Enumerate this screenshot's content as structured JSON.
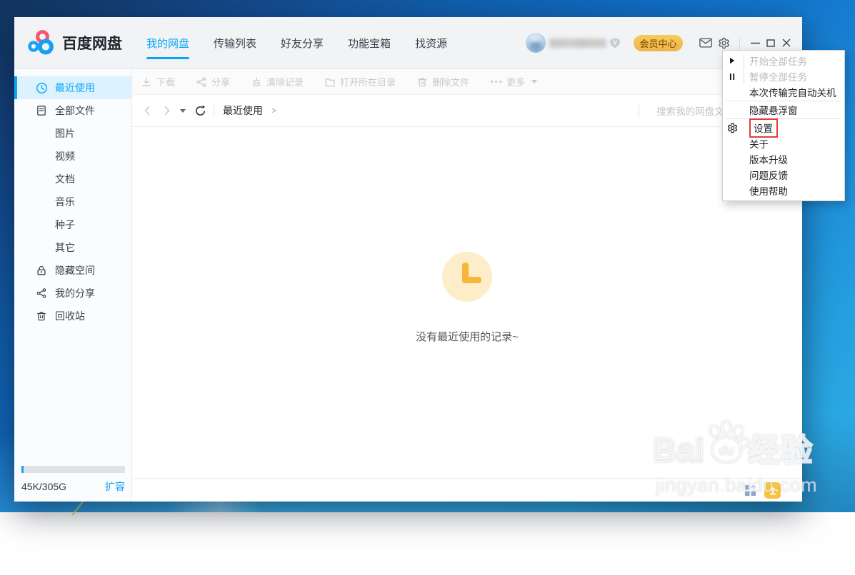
{
  "app": {
    "title": "百度网盘"
  },
  "titlebar": {
    "nav": [
      {
        "label": "我的网盘",
        "active": true
      },
      {
        "label": "传输列表",
        "active": false
      },
      {
        "label": "好友分享",
        "active": false
      },
      {
        "label": "功能宝箱",
        "active": false
      },
      {
        "label": "找资源",
        "active": false
      }
    ],
    "member_button": "会员中心"
  },
  "toolbar": {
    "buttons": [
      {
        "label": "下载",
        "icon": "download"
      },
      {
        "label": "分享",
        "icon": "share"
      },
      {
        "label": "清除记录",
        "icon": "clear"
      },
      {
        "label": "打开所在目录",
        "icon": "folder"
      },
      {
        "label": "删除文件",
        "icon": "trash"
      },
      {
        "label": "更多",
        "icon": "more",
        "chevron": true
      }
    ]
  },
  "breadcrumb": {
    "current": "最近使用",
    "chevron": ">"
  },
  "search": {
    "placeholder": "搜索我的网盘文件"
  },
  "sidebar": {
    "items": [
      {
        "label": "最近使用",
        "icon": "clock",
        "active": true
      },
      {
        "label": "全部文件",
        "icon": "file"
      },
      {
        "label": "图片",
        "indent": true
      },
      {
        "label": "视频",
        "indent": true
      },
      {
        "label": "文档",
        "indent": true
      },
      {
        "label": "音乐",
        "indent": true
      },
      {
        "label": "种子",
        "indent": true
      },
      {
        "label": "其它",
        "indent": true
      },
      {
        "label": "隐藏空间",
        "icon": "lock"
      },
      {
        "label": "我的分享",
        "icon": "share"
      },
      {
        "label": "回收站",
        "icon": "trash"
      }
    ],
    "storage": {
      "usage": "45K/305G",
      "upgrade": "扩容"
    }
  },
  "content": {
    "empty_message": "没有最近使用的记录~"
  },
  "context_menu": {
    "items": [
      {
        "label": "开始全部任务",
        "icon": "play",
        "disabled": true
      },
      {
        "label": "暂停全部任务",
        "icon": "pause",
        "disabled": true
      },
      {
        "label": "本次传输完自动关机"
      },
      {
        "divider": true
      },
      {
        "label": "隐藏悬浮窗"
      },
      {
        "divider": true
      },
      {
        "label": "设置",
        "icon": "gear",
        "highlighted": true
      },
      {
        "label": "关于"
      },
      {
        "label": "版本升级"
      },
      {
        "label": "问题反馈"
      },
      {
        "label": "使用帮助"
      }
    ]
  },
  "watermark": {
    "brand": "Bai",
    "brand_mid": "du",
    "brand_suffix": "经验",
    "url": "jingyan.baidu.com"
  },
  "colors": {
    "accent": "#09a6f7",
    "member_gold": "#f6c54b",
    "empty_circle": "#fdeec9",
    "empty_clock": "#f7b637",
    "highlight": "#e23c3c"
  }
}
